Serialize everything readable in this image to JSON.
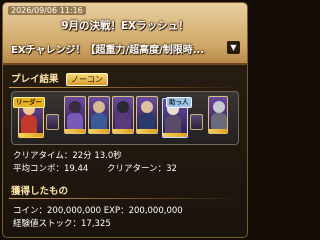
{
  "header": {
    "timestamp": "2026/09/06 11:16",
    "event_title": "9月の決戦！EXラッシュ！",
    "quest_title": "EXチャレンジ！【超重力/超高度/制限時..."
  },
  "play_result": {
    "section_label": "プレイ結果",
    "badge_label": "ノーコン",
    "leader_label": "リーダー",
    "friend_label": "助っ人",
    "clear_time": "クリアタイム：22分 13.0秒",
    "avg_combo": "平均コンボ：19.44",
    "clear_turns": "クリアターン：32"
  },
  "rewards": {
    "section_label": "獲得したもの",
    "coin_exp": "コイン：200,000,000 EXP：200,000,000",
    "exp_stock": "経験値ストック：17,325"
  },
  "colors": {
    "header_gold": "#cfa868",
    "panel_bg": "#231a10",
    "leader_tag": "#e7b120",
    "friend_tag": "#9fc4e6"
  }
}
